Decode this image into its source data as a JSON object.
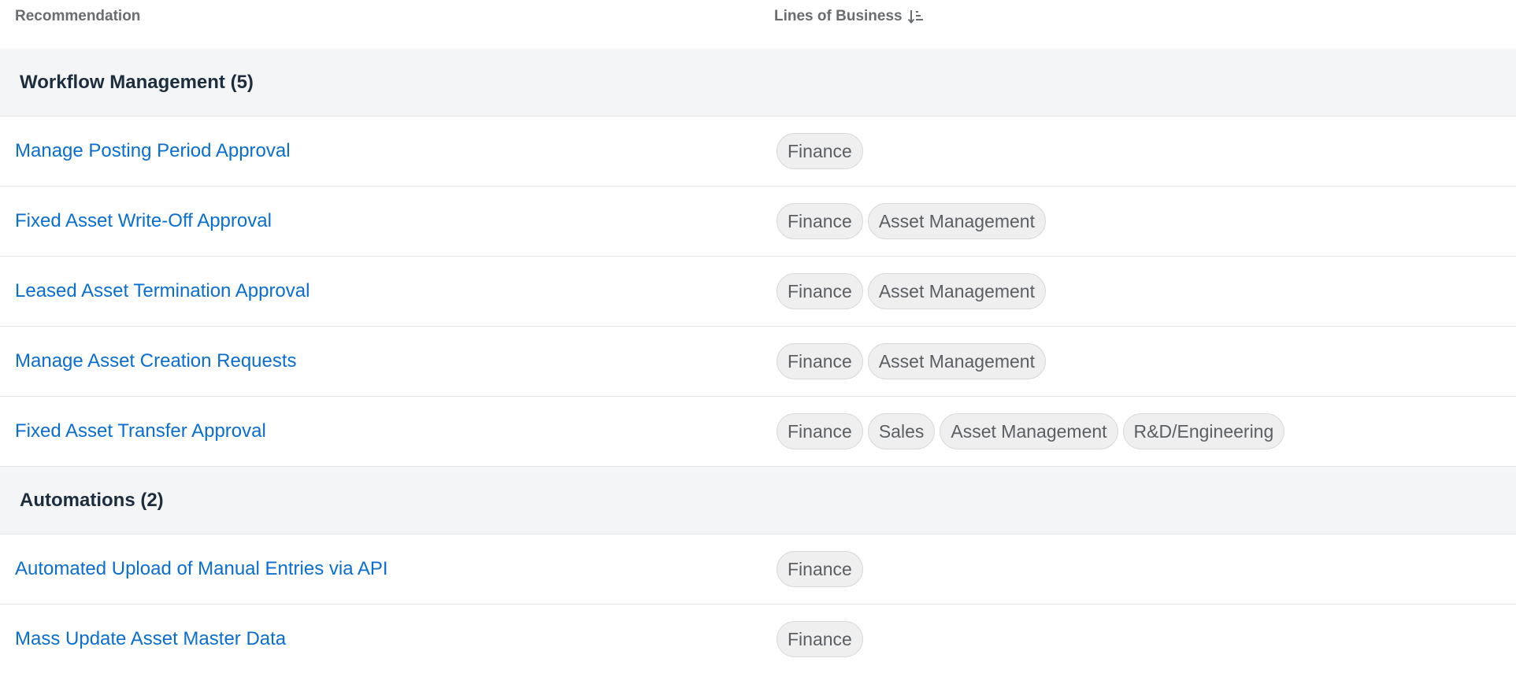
{
  "columns": {
    "recommendation": "Recommendation",
    "lines_of_business": "Lines of Business",
    "sort_icon": "sort-descending-icon"
  },
  "groups": [
    {
      "title": "Workflow Management (5)",
      "items": [
        {
          "label": "Manage Posting Period Approval",
          "tags": [
            "Finance"
          ]
        },
        {
          "label": "Fixed Asset Write-Off Approval",
          "tags": [
            "Finance",
            "Asset Management"
          ]
        },
        {
          "label": "Leased Asset Termination Approval",
          "tags": [
            "Finance",
            "Asset Management"
          ]
        },
        {
          "label": "Manage Asset Creation Requests",
          "tags": [
            "Finance",
            "Asset Management"
          ]
        },
        {
          "label": "Fixed Asset Transfer Approval",
          "tags": [
            "Finance",
            "Sales",
            "Asset Management",
            "R&D/Engineering"
          ]
        }
      ]
    },
    {
      "title": "Automations (2)",
      "items": [
        {
          "label": "Automated Upload of Manual Entries via API",
          "tags": [
            "Finance"
          ]
        },
        {
          "label": "Mass Update Asset Master Data",
          "tags": [
            "Finance"
          ]
        }
      ]
    }
  ],
  "colors": {
    "link": "#0a6ed1",
    "group_background": "#f4f5f6",
    "tag_background": "#efefef"
  }
}
